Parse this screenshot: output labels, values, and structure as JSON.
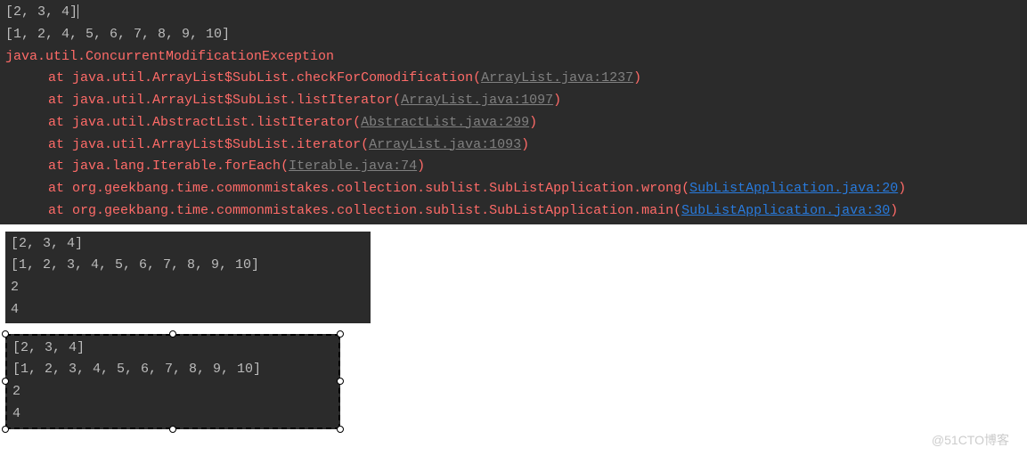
{
  "block1": {
    "line1": "[2, 3, 4]",
    "line2": "[1, 2, 4, 5, 6, 7, 8, 9, 10]",
    "exception": "java.util.ConcurrentModificationException",
    "trace": [
      {
        "at": "at ",
        "loc": "java.util.ArrayList$SubList.checkForComodification",
        "open": "(",
        "link": "ArrayList.java:1237",
        "close": ")",
        "linkType": "gray"
      },
      {
        "at": "at ",
        "loc": "java.util.ArrayList$SubList.listIterator",
        "open": "(",
        "link": "ArrayList.java:1097",
        "close": ")",
        "linkType": "gray"
      },
      {
        "at": "at ",
        "loc": "java.util.AbstractList.listIterator",
        "open": "(",
        "link": "AbstractList.java:299",
        "close": ")",
        "linkType": "gray"
      },
      {
        "at": "at ",
        "loc": "java.util.ArrayList$SubList.iterator",
        "open": "(",
        "link": "ArrayList.java:1093",
        "close": ")",
        "linkType": "gray"
      },
      {
        "at": "at ",
        "loc": "java.lang.Iterable.forEach",
        "open": "(",
        "link": "Iterable.java:74",
        "close": ")",
        "linkType": "gray"
      },
      {
        "at": "at ",
        "loc": "org.geekbang.time.commonmistakes.collection.sublist.SubListApplication.wrong",
        "open": "(",
        "link": "SubListApplication.java:20",
        "close": ")",
        "linkType": "blue"
      },
      {
        "at": "at ",
        "loc": "org.geekbang.time.commonmistakes.collection.sublist.SubListApplication.main",
        "open": "(",
        "link": "SubListApplication.java:30",
        "close": ")",
        "linkType": "blue"
      }
    ]
  },
  "block2": {
    "line1": "[2, 3, 4]",
    "line2": "[1, 2, 3, 4, 5, 6, 7, 8, 9, 10]",
    "line3": "2",
    "line4": "4"
  },
  "block3": {
    "line1": "[2, 3, 4]",
    "line2": "[1, 2, 3, 4, 5, 6, 7, 8, 9, 10]",
    "line3": "2",
    "line4": "4"
  },
  "watermark": "@51CTO博客"
}
